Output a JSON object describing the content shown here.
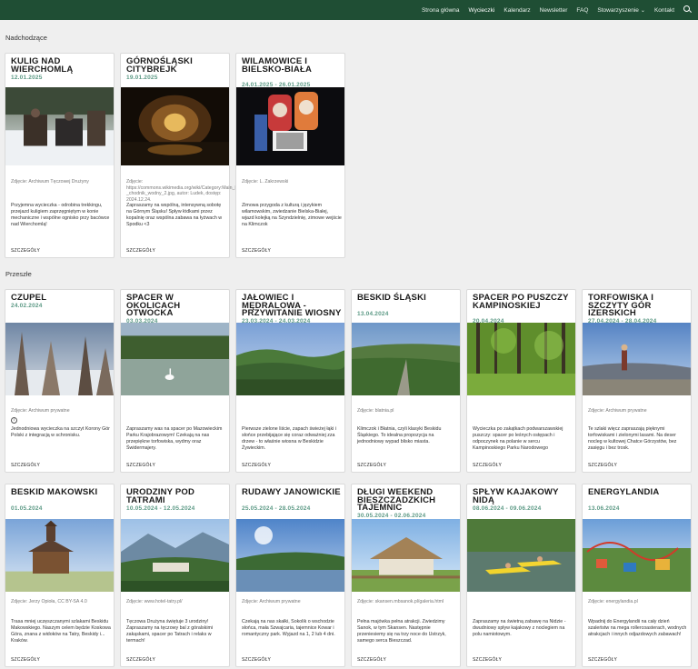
{
  "nav": {
    "items": [
      "Strona główna",
      "Wycieczki",
      "Kalendarz",
      "Newsletter",
      "FAQ",
      "Stowarzyszenie",
      "Kontakt"
    ],
    "active": "Wycieczki"
  },
  "sections": {
    "upcoming": "Nadchodzące",
    "past": "Przeszłe"
  },
  "details_label": "SZCZEGÓŁY",
  "upcoming": [
    {
      "title": "KULIG NAD WIERCHOMLĄ",
      "date": "12.01.2025",
      "credit": "Zdjęcie: Archiwum Tęczowej Drużyny",
      "desc": "Przyjemna wycieczka - odrobina trekkingu, przejazd kuligiem zaprzęgniętym w konie mechaniczne i wspólne ognisko przy bacówce nad Wierchomlą!"
    },
    {
      "title": "GÓRNOŚLĄSKI CITYBREJK",
      "date": "19.01.2025",
      "credit": "Zdjęcie: https://commons.wikimedia.org/wiki/Category:Main_Key_Hereditary_Adit#/media/File:GK5D_-_chodnik_wodny_2.jpg, autor: Ludek, dostęp: 2024.12.24.",
      "desc": "Zapraszamy na wspólną, intensywną sobotę na Górnym Śląsku! Spływ łódkami przez kopalnię oraz wspólna zabawa na łyżwach w Spodku <3"
    },
    {
      "title": "WILAMOWICE I BIELSKO-BIAŁA",
      "date": "24.01.2025 - 26.01.2025",
      "credit": "Zdjęcie: L. Zakrzewski",
      "desc": "Zimowa przygoda z kulturą i językiem wilamowskim, zwiedzanie Bielska-Białej, wjazd kolejką na Szyndzielnię, zimowe wejście na Klimczok"
    }
  ],
  "past": [
    {
      "title": "CZUPEL",
      "date": "24.02.2024",
      "credit": "Zdjęcie: Archiwum prywatne",
      "desc": "Jednodniowa wycieczka na szczyt Korony Gór Polski z integracją w schronisku."
    },
    {
      "title": "SPACER W OKOLICACH OTWOCKA",
      "date": "03.03.2024",
      "credit": "",
      "desc": "Zapraszamy was na spacer po Mazowieckim Parku Krajobrazowym! Czekają na nas przepiękne torfowiska, wydmy oraz Świdermajery."
    },
    {
      "title": "JAŁOWIEC I MĘDRALOWA - PRZYWITANIE WIOSNY",
      "date": "23.03.2024 - 24.03.2024",
      "credit": "",
      "desc": "Pierwsze zielone liście, zapach świeżej łąki i słońce przebijające się coraz odważniej zza drzew - to właśnie wiosna w Beskidzie Żywieckim."
    },
    {
      "title": "BESKID ŚLĄSKI",
      "date": "13.04.2024",
      "credit": "Zdjęcie: blatnia.pl",
      "desc": "Klimczok i Błatnia, czyli klasyki Beskidu Śląskiego. To idealna propozycja na jednodniowy wypad blisko miasta."
    },
    {
      "title": "SPACER PO PUSZCZY KAMPINOSKIEJ",
      "date": "20.04.2024",
      "credit": "",
      "desc": "Wycieczka po zakątkach podwarszawskiej puszczy: spacer po leśnych ostępach i odpoczynek na polanie w sercu Kampinoskiego Parku Narodowego"
    },
    {
      "title": "TORFOWISKA I SZCZYTY GÓR IZERSKICH",
      "date": "27.04.2024 - 28.04.2024",
      "credit": "Zdjęcie: Archiwum prywatne",
      "desc": "Te szlaki więcz zapraszają pięknymi torfowiskami i zielonymi lasami. Na deser nocleg w kultowej Chatce Górzystów, bez zasięgu i bez trosk."
    },
    {
      "title": "BESKID MAKOWSKI",
      "date": "01.05.2024",
      "credit": "Zdjęcie: Jerzy Opioła, CC BY-SA 4.0",
      "desc": "Trasa mniej uczęszczanymi szlakami Beskidu Makowskiego. Naszym celem będzie Koskowa Góra, znana z widoków na Tatry, Beskidy i... Kraków."
    },
    {
      "title": "URODZINY POD TATRAMI",
      "date": "10.05.2024 - 12.05.2024",
      "credit": "Zdjęcie: www.hotel-tatry.pl/",
      "desc": "Tęczowa Drużyna świętuje 3 urodziny! Zapraszamy na tęczowy bal z góralskimi zakąskami, spacer po Tatrach i relaks w termach!"
    },
    {
      "title": "RUDAWY JANOWICKIE",
      "date": "25.05.2024 - 28.05.2024",
      "credit": "Zdjęcie: Archiwum prywatne",
      "desc": "Czekają na nas skałki, Sokolik o wschodzie słońca, mała Szwajcaria, tajemnice Kowar i romantyczny park. Wyjazd na 1, 2 lub 4 dni."
    },
    {
      "title": "DŁUGI WEEKEND BIESZCZADZKICH TAJEMNIC",
      "date": "30.05.2024 - 02.06.2024",
      "credit": "Zdjęcie: skansen.mbsanok.pl/galeria.html",
      "desc": "Pełna majówka pełna atrakcji. Zwiedzimy Sanok, w tym Skansen. Następnie przeniesiemy się na trzy noce do Ustrzyk, samego serca Bieszczad."
    },
    {
      "title": "SPŁYW KAJAKOWY NIDĄ",
      "date": "08.06.2024 - 09.06.2024",
      "credit": "",
      "desc": "Zapraszamy na świetną zabawę na Nidzie - dwudniowy spływ kajakowy z noclegiem na polu namiotowym."
    },
    {
      "title": "ENERGYLANDIA",
      "date": "13.06.2024",
      "credit": "Zdjęcie: energylandia.pl",
      "desc": "Wpadnij do Energylandii na cały dzień szaleństw na mega rollercoasterach, wodnych atrakcjach i innych odjazdowych zabawach!"
    }
  ],
  "colors": {
    "nav_bg": "#1f4e34",
    "date": "#5d9a86",
    "page_bg": "#efefef"
  }
}
